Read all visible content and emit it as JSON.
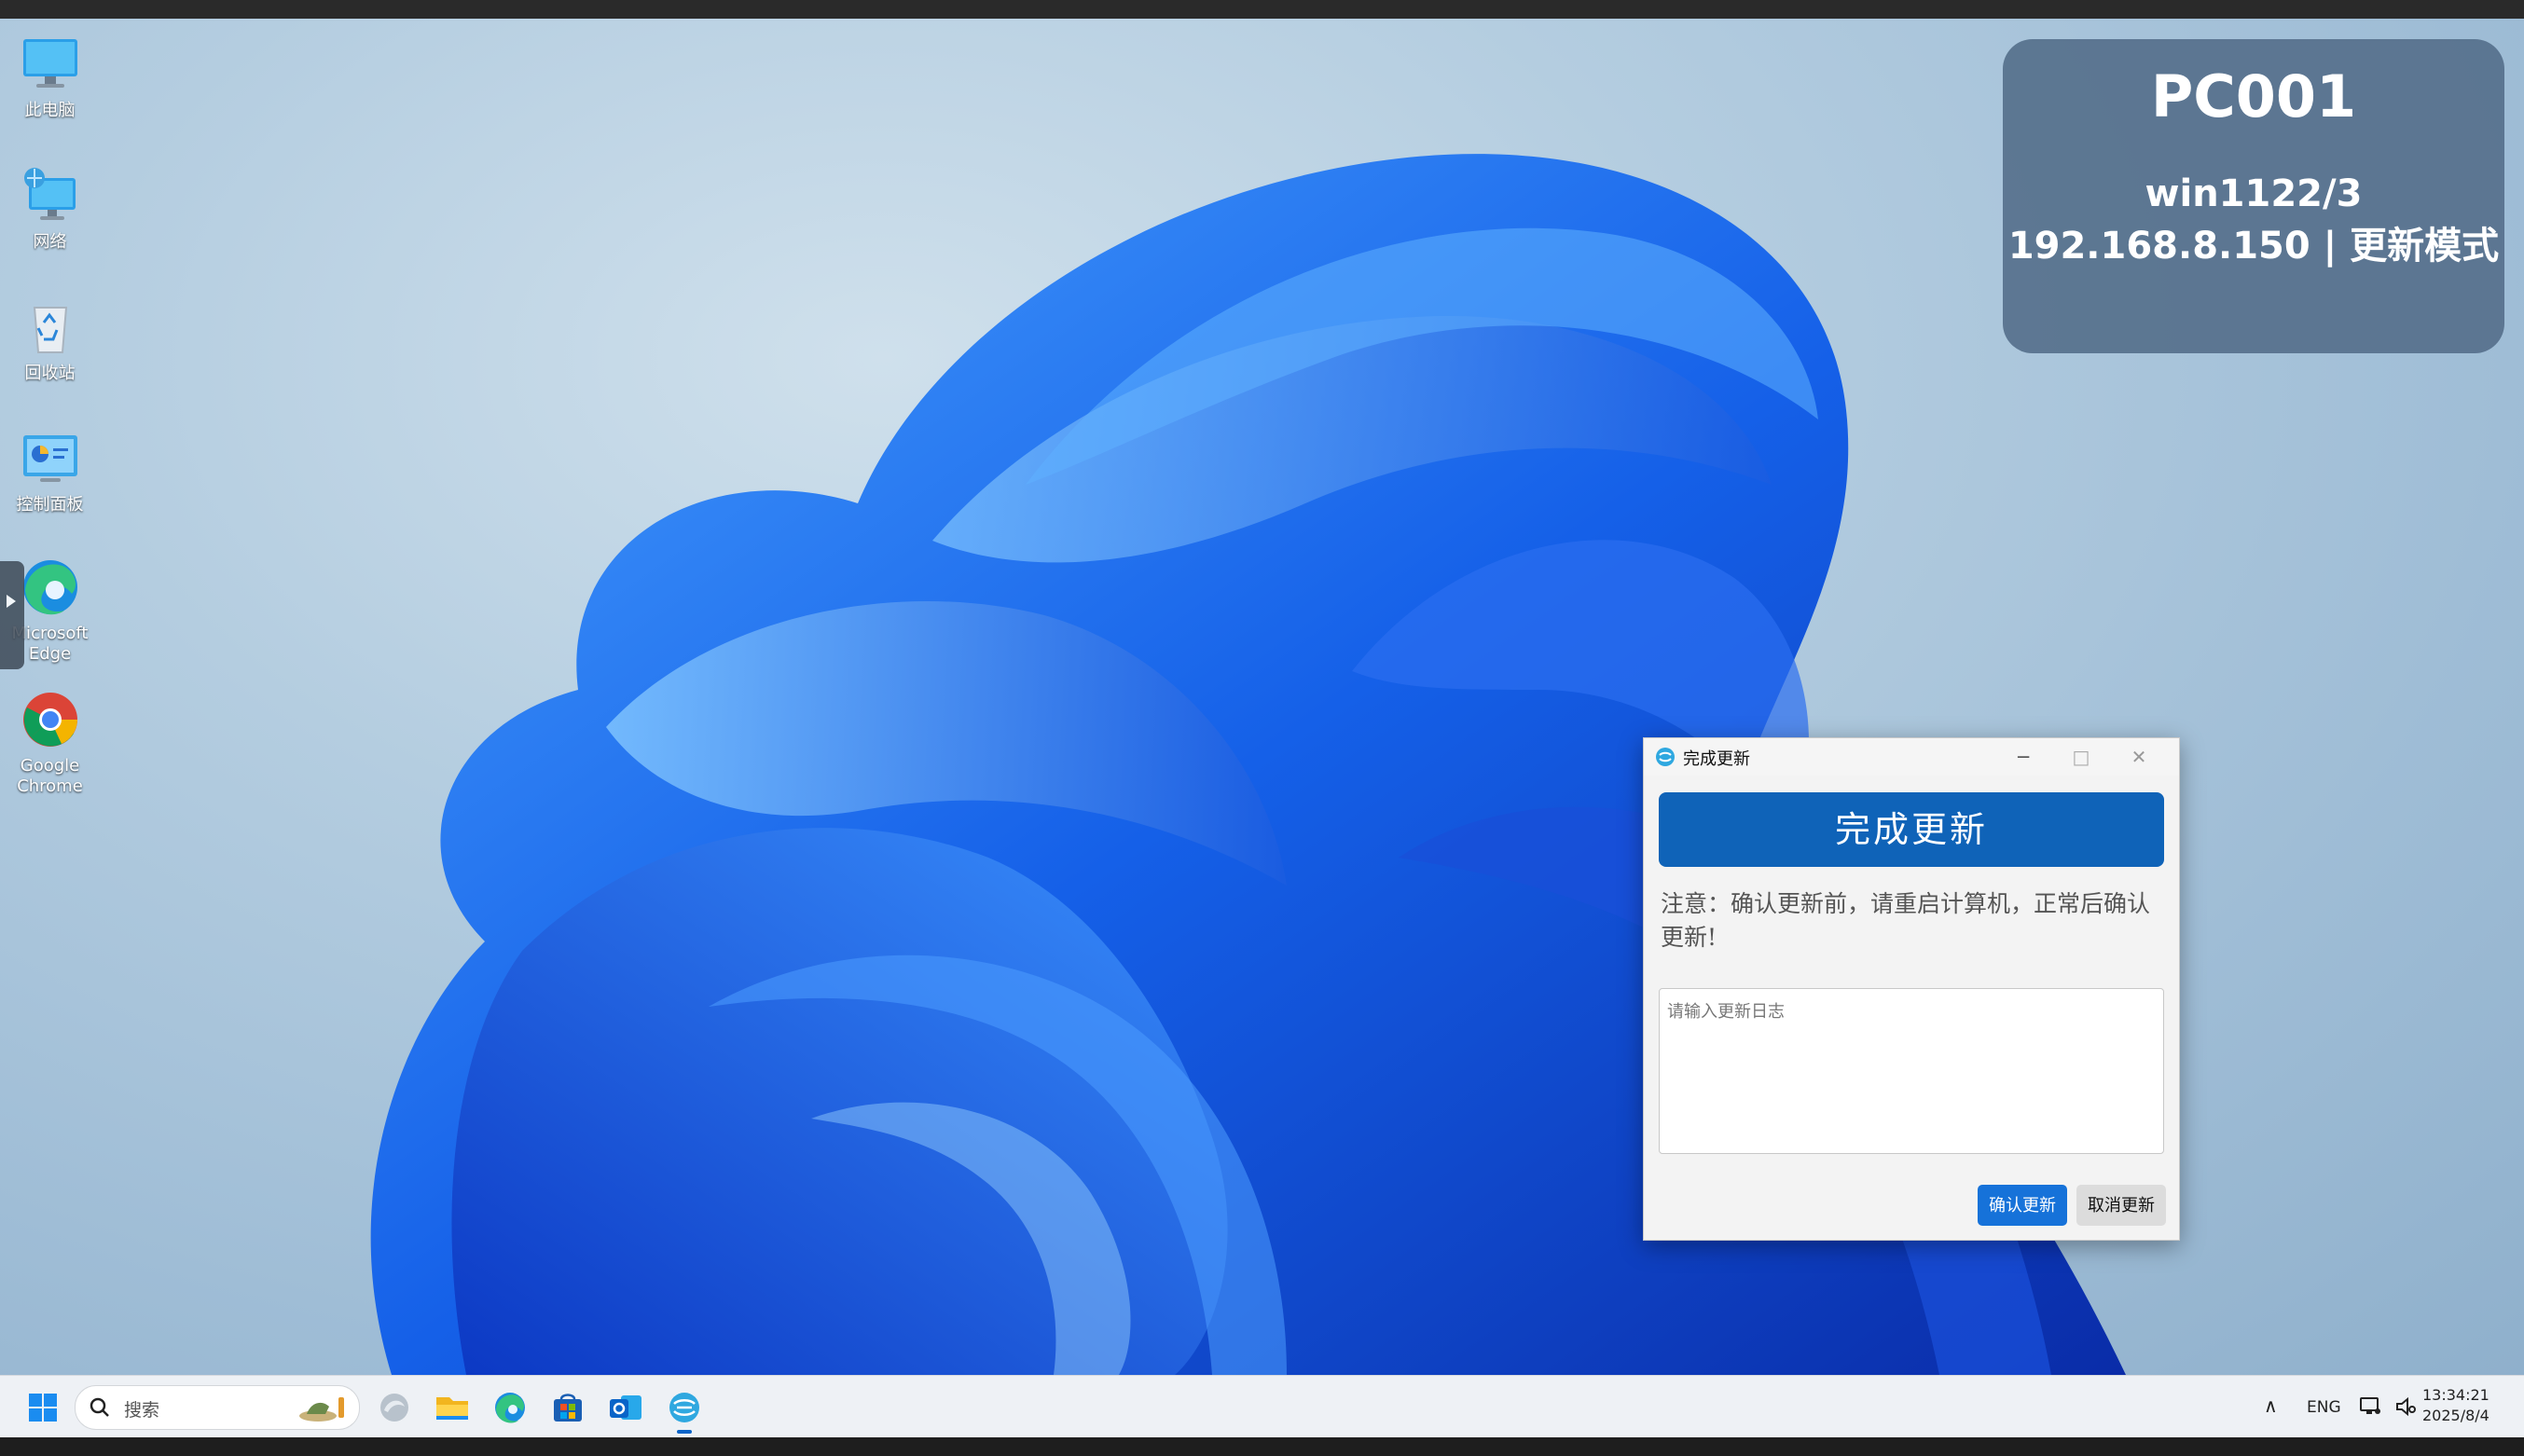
{
  "desktop": {
    "icons": [
      {
        "label": "此电脑",
        "icon": "monitor-icon"
      },
      {
        "label": "网络",
        "icon": "network-icon"
      },
      {
        "label": "回收站",
        "icon": "recycle-bin-icon"
      },
      {
        "label": "控制面板",
        "icon": "control-panel-icon"
      },
      {
        "label": "Microsoft Edge",
        "icon": "edge-icon"
      },
      {
        "label": "Google Chrome",
        "icon": "chrome-icon"
      }
    ]
  },
  "info_panel": {
    "pc_name": "PC001",
    "os_info": "win1122/3",
    "ip_mode": "192.168.8.150 | 更新模式"
  },
  "dialog": {
    "title": "完成更新",
    "banner": "完成更新",
    "notice": "注意：确认更新前，请重启计算机，正常后确认更新!",
    "log_placeholder": "请输入更新日志",
    "confirm_label": "确认更新",
    "cancel_label": "取消更新"
  },
  "taskbar": {
    "search_placeholder": "搜索",
    "language": "ENG",
    "time": "13:34:21",
    "date": "2025/8/4",
    "pinned_icons": [
      "copilot-icon",
      "file-explorer-icon",
      "edge-icon",
      "store-icon",
      "outlook-icon",
      "update-client-icon"
    ]
  },
  "colors": {
    "accent": "#0f63b8",
    "button_primary": "#1672d9",
    "panel_bg": "#56708c"
  }
}
